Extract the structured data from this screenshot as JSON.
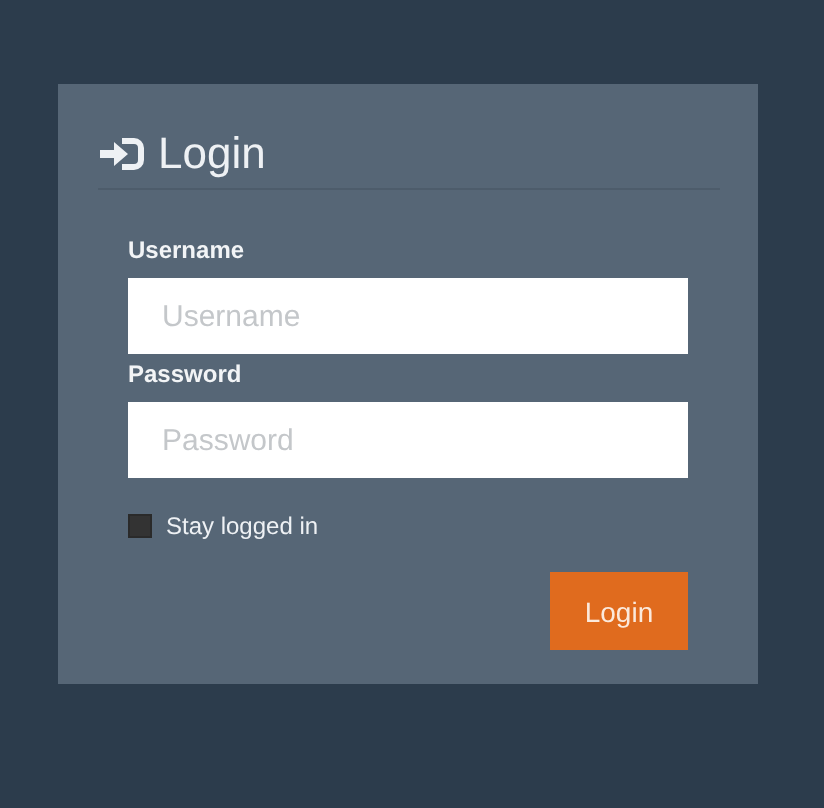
{
  "title": "Login",
  "fields": [
    {
      "label": "Username",
      "placeholder": "Username"
    },
    {
      "label": "Password",
      "placeholder": "Password"
    }
  ],
  "remember": {
    "label": "Stay logged in",
    "checked": false
  },
  "submit": {
    "label": "Login"
  }
}
